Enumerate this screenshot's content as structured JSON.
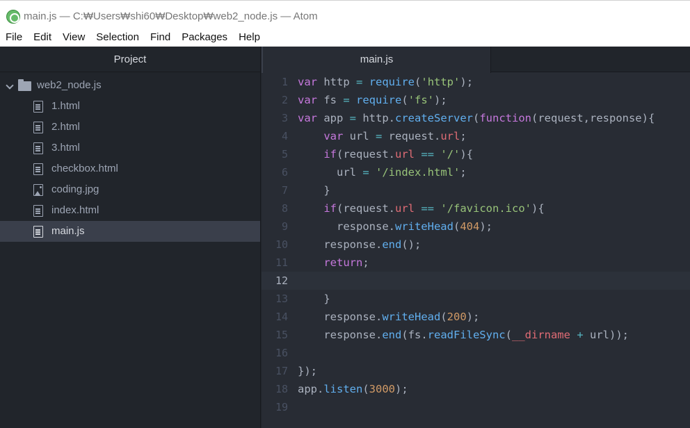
{
  "window": {
    "title": "main.js — C:₩Users₩shi60₩Desktop₩web2_node.js — Atom",
    "app_icon": "atom-icon"
  },
  "menu": [
    "File",
    "Edit",
    "View",
    "Selection",
    "Find",
    "Packages",
    "Help"
  ],
  "sidebar": {
    "header": "Project",
    "root": {
      "name": "web2_node.js",
      "expanded": true,
      "icon": "folder-icon"
    },
    "files": [
      {
        "name": "1.html",
        "icon": "file-text-icon",
        "selected": false
      },
      {
        "name": "2.html",
        "icon": "file-text-icon",
        "selected": false
      },
      {
        "name": "3.html",
        "icon": "file-text-icon",
        "selected": false
      },
      {
        "name": "checkbox.html",
        "icon": "file-text-icon",
        "selected": false
      },
      {
        "name": "coding.jpg",
        "icon": "file-image-icon",
        "selected": false
      },
      {
        "name": "index.html",
        "icon": "file-text-icon",
        "selected": false
      },
      {
        "name": "main.js",
        "icon": "file-text-icon",
        "selected": true
      }
    ]
  },
  "editor": {
    "active_tab": "main.js",
    "cursor_line": 12,
    "colors": {
      "keyword": "#c678dd",
      "function": "#61afef",
      "string": "#98c379",
      "number": "#d19a66",
      "property": "#e06c75",
      "operator": "#56b6c2",
      "plain": "#abb2bf"
    },
    "lines": [
      [
        [
          "kw",
          "var"
        ],
        [
          "pl",
          " http "
        ],
        [
          "op",
          "="
        ],
        [
          "pl",
          " "
        ],
        [
          "fn",
          "require"
        ],
        [
          "pl",
          "("
        ],
        [
          "str",
          "'http'"
        ],
        [
          "pl",
          ");"
        ]
      ],
      [
        [
          "kw",
          "var"
        ],
        [
          "pl",
          " fs "
        ],
        [
          "op",
          "="
        ],
        [
          "pl",
          " "
        ],
        [
          "fn",
          "require"
        ],
        [
          "pl",
          "("
        ],
        [
          "str",
          "'fs'"
        ],
        [
          "pl",
          ");"
        ]
      ],
      [
        [
          "kw",
          "var"
        ],
        [
          "pl",
          " app "
        ],
        [
          "op",
          "="
        ],
        [
          "pl",
          " http."
        ],
        [
          "fn",
          "createServer"
        ],
        [
          "pl",
          "("
        ],
        [
          "kw",
          "function"
        ],
        [
          "pl",
          "(request,response){"
        ]
      ],
      [
        [
          "pl",
          "    "
        ],
        [
          "kw",
          "var"
        ],
        [
          "pl",
          " url "
        ],
        [
          "op",
          "="
        ],
        [
          "pl",
          " request."
        ],
        [
          "prop",
          "url"
        ],
        [
          "pl",
          ";"
        ]
      ],
      [
        [
          "pl",
          "    "
        ],
        [
          "kw",
          "if"
        ],
        [
          "pl",
          "(request."
        ],
        [
          "prop",
          "url"
        ],
        [
          "pl",
          " "
        ],
        [
          "op",
          "=="
        ],
        [
          "pl",
          " "
        ],
        [
          "str",
          "'/'"
        ],
        [
          "pl",
          "){"
        ]
      ],
      [
        [
          "pl",
          "      url "
        ],
        [
          "op",
          "="
        ],
        [
          "pl",
          " "
        ],
        [
          "str",
          "'/index.html'"
        ],
        [
          "pl",
          ";"
        ]
      ],
      [
        [
          "pl",
          "    }"
        ]
      ],
      [
        [
          "pl",
          "    "
        ],
        [
          "kw",
          "if"
        ],
        [
          "pl",
          "(request."
        ],
        [
          "prop",
          "url"
        ],
        [
          "pl",
          " "
        ],
        [
          "op",
          "=="
        ],
        [
          "pl",
          " "
        ],
        [
          "str",
          "'/favicon.ico'"
        ],
        [
          "pl",
          "){"
        ]
      ],
      [
        [
          "pl",
          "      response."
        ],
        [
          "fn",
          "writeHead"
        ],
        [
          "pl",
          "("
        ],
        [
          "num",
          "404"
        ],
        [
          "pl",
          ");"
        ]
      ],
      [
        [
          "pl",
          "    response."
        ],
        [
          "fn",
          "end"
        ],
        [
          "pl",
          "();"
        ]
      ],
      [
        [
          "pl",
          "    "
        ],
        [
          "kw",
          "return"
        ],
        [
          "pl",
          ";"
        ]
      ],
      [],
      [
        [
          "pl",
          "    }"
        ]
      ],
      [
        [
          "pl",
          "    response."
        ],
        [
          "fn",
          "writeHead"
        ],
        [
          "pl",
          "("
        ],
        [
          "num",
          "200"
        ],
        [
          "pl",
          ");"
        ]
      ],
      [
        [
          "pl",
          "    response."
        ],
        [
          "fn",
          "end"
        ],
        [
          "pl",
          "(fs."
        ],
        [
          "fn",
          "readFileSync"
        ],
        [
          "pl",
          "("
        ],
        [
          "prop",
          "__dirname"
        ],
        [
          "pl",
          " "
        ],
        [
          "op",
          "+"
        ],
        [
          "pl",
          " url));"
        ]
      ],
      [],
      [
        [
          "pl",
          "});"
        ]
      ],
      [
        [
          "pl",
          "app."
        ],
        [
          "fn",
          "listen"
        ],
        [
          "pl",
          "("
        ],
        [
          "num",
          "3000"
        ],
        [
          "pl",
          ");"
        ]
      ],
      []
    ]
  }
}
